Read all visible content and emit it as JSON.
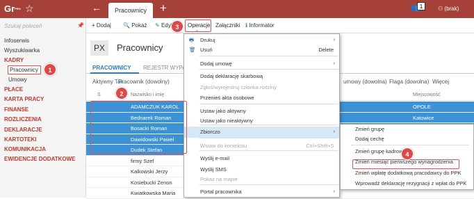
{
  "app": {
    "logo_text": "Gr",
    "logo_sup": "PRO",
    "tab_title": "Pracownicy",
    "notif_count": "1",
    "user": "(brak)"
  },
  "sidebar": {
    "search_placeholder": "Szukaj poleceń",
    "items": [
      "Infoserwis",
      "Wyszukiwarka",
      "KADRY",
      "Pracownicy",
      "Umowy",
      "PŁACE",
      "KARTA PRACY",
      "FINANSE",
      "ROZLICZENIA",
      "DEKLARACJE",
      "KARTOTEKI",
      "KOMUNIKACJA",
      "EWIDENCJE DODATKOWE"
    ]
  },
  "toolbar": {
    "add": "Dodaj",
    "show": "Pokaż",
    "edit": "Edytuj",
    "operations": "Operacje",
    "attachments": "Załączniki",
    "informator": "Informator"
  },
  "page": {
    "code": "PX",
    "title": "Pracownicy"
  },
  "subtabs": [
    "PRACOWNICY",
    "REJESTR WYPA"
  ],
  "filters": {
    "active_label": "Aktywny",
    "active_value": "Tak",
    "employee": "Pracownik (dowolny)",
    "contract": "umowy (dowolna)",
    "flag": "Flaga (dowolna)",
    "more": "Więcej"
  },
  "grid": {
    "headers": {
      "s": "S",
      "p": "P",
      "name": "Nazwisko i imię",
      "city": "Miejscowość"
    },
    "rows": [
      {
        "name": "ADAMCZUK KAROL",
        "city": "OPOLE",
        "sel": true
      },
      {
        "name": "Bednarek Roman",
        "city": "Katowice",
        "sel": true
      },
      {
        "name": "Bosacki Roman",
        "city": "",
        "sel": true
      },
      {
        "name": "Dawidowski Paweł",
        "city": "",
        "sel": true
      },
      {
        "name": "Dudek Stefan",
        "city": "",
        "sel": true
      },
      {
        "name": "firmy Szef",
        "city": "",
        "sel": false
      },
      {
        "name": "Kalkowski Jerzy",
        "city": "",
        "sel": false
      },
      {
        "name": "Kosiebucki Zenon",
        "city": "",
        "sel": false
      },
      {
        "name": "Kwiatkowska Maria",
        "city": "",
        "sel": false
      }
    ]
  },
  "menu": {
    "items": [
      {
        "label": "Drukuj",
        "shortcut": "",
        "arrow": true,
        "icon": "print-icon"
      },
      {
        "label": "Usuń",
        "shortcut": "Delete",
        "arrow": false,
        "icon": "delete-icon"
      },
      {
        "label": "Dodaj umowę",
        "shortcut": "",
        "arrow": true,
        "icon": ""
      },
      {
        "label": "Dodaj deklarację skarbową",
        "shortcut": "",
        "arrow": false,
        "icon": ""
      },
      {
        "label": "Zgłoś/wyrejestruj członka rodziny",
        "shortcut": "",
        "arrow": false,
        "icon": "",
        "disabled": true
      },
      {
        "label": "Przenieś akta osobowe",
        "shortcut": "",
        "arrow": false,
        "icon": ""
      },
      {
        "label": "Ustaw jako aktywny",
        "shortcut": "",
        "arrow": false,
        "icon": ""
      },
      {
        "label": "Ustaw jako nieaktywny",
        "shortcut": "",
        "arrow": false,
        "icon": ""
      },
      {
        "label": "Zbiorczo",
        "shortcut": "",
        "arrow": true,
        "icon": "",
        "hover": true
      },
      {
        "label": "Wstaw do kontekstu",
        "shortcut": "Ctrl+Shift+5",
        "arrow": false,
        "icon": "",
        "disabled": true
      },
      {
        "label": "Wyślij e-mail",
        "shortcut": "",
        "arrow": false,
        "icon": ""
      },
      {
        "label": "Wyślij SMS",
        "shortcut": "",
        "arrow": false,
        "icon": ""
      },
      {
        "label": "Pokaż na mapie",
        "shortcut": "",
        "arrow": false,
        "icon": "",
        "disabled": true
      },
      {
        "label": "Portal pracownika",
        "shortcut": "",
        "arrow": true,
        "icon": ""
      }
    ]
  },
  "submenu": {
    "items": [
      "Zmień grupę",
      "Dodaj cechę",
      "Zmień grupę kadrową",
      "Zmień miesiąc pierwszego wynagrodzenia",
      "Zmień wpłatę dodatkową pracodawcy do PPK",
      "Wprowadź deklarację rezygnacji z wpłat do PPK"
    ]
  },
  "badges": [
    "1",
    "2",
    "3",
    "4"
  ],
  "colors": {
    "topbar": "#a6413a",
    "selection": "#3c92d4",
    "accent_red": "#c0392b",
    "badge": "#e04848"
  }
}
